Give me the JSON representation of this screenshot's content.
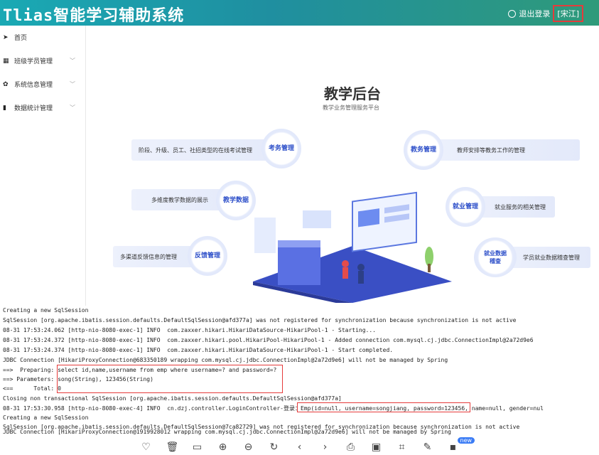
{
  "header": {
    "app_title": "Tlias智能学习辅助系统",
    "logout_label": "退出登录",
    "user_label": "[宋江]"
  },
  "sidebar": {
    "items": [
      {
        "icon": "send-icon",
        "label": "首页"
      },
      {
        "icon": "grid-icon",
        "label": "班级学员管理"
      },
      {
        "icon": "gear-icon",
        "label": "系统信息管理"
      },
      {
        "icon": "bar-chart-icon",
        "label": "数据统计管理"
      }
    ]
  },
  "hero": {
    "title": "教学后台",
    "subtitle": "教学业务管理服务平台"
  },
  "features": [
    {
      "name": "考务管理",
      "desc": "阶段、升级、员工、社招类型的在线考试管理"
    },
    {
      "name": "教务管理",
      "desc": "教师安排等教务工作的管理"
    },
    {
      "name": "教学数据",
      "desc": "多维度教学数据的展示"
    },
    {
      "name": "就业管理",
      "desc": "就业服务的相关管理"
    },
    {
      "name": "反馈管理",
      "desc": "多渠道反馈信息的管理"
    },
    {
      "name": "就业数据稽查",
      "desc": "学员就业数据稽查管理"
    }
  ],
  "console": {
    "lines": [
      "Creating a new SqlSession",
      "SqlSession [org.apache.ibatis.session.defaults.DefaultSqlSession@afd377a] was not registered for synchronization because synchronization is not active",
      "08-31 17:53:24.062 [http-nio-8080-exec-1] INFO  com.zaxxer.hikari.HikariDataSource-HikariPool-1 - Starting...",
      "08-31 17:53:24.372 [http-nio-8080-exec-1] INFO  com.zaxxer.hikari.pool.HikariPool-HikariPool-1 - Added connection com.mysql.cj.jdbc.ConnectionImpl@2a72d9e6",
      "08-31 17:53:24.374 [http-nio-8080-exec-1] INFO  com.zaxxer.hikari.HikariDataSource-HikariPool-1 - Start completed.",
      "JDBC Connection [HikariProxyConnection@683350189 wrapping com.mysql.cj.jdbc.ConnectionImpl@2a72d9e6] will not be managed by Spring",
      "==>  Preparing: select id,name,username from emp where username=? and password=?",
      "==> Parameters: song(String), 123456(String)",
      "<==      Total: 0",
      "Closing non transactional SqlSession [org.apache.ibatis.session.defaults.DefaultSqlSession@afd377a]",
      "08-31 17:53:30.958 [http-nio-8080-exec-4] INFO  cn.dzj.controller.LoginController-登录：Emp(id=null, username=songjiang, password=123456, name=null, gender=nul",
      "Creating a new SqlSession",
      "SqlSession [org.apache.ibatis.session.defaults.DefaultSqlSession@7ca82729] was not registered for synchronization because synchronization is not active",
      "JDBC Connection [HikariProxyConnection@1919928012 wrapping com.mysql.cj.jdbc.ConnectionImpl@2a72d9e6] will not be managed by Spring"
    ]
  },
  "toolbar": {
    "buttons": [
      "heart-icon",
      "trash-icon",
      "frame-icon",
      "zoom-in-icon",
      "zoom-out-icon",
      "rotate-icon",
      "prev-icon",
      "next-icon",
      "print-icon",
      "image-icon",
      "crop-icon",
      "edit-icon",
      "apps-icon"
    ],
    "badge": "new"
  }
}
